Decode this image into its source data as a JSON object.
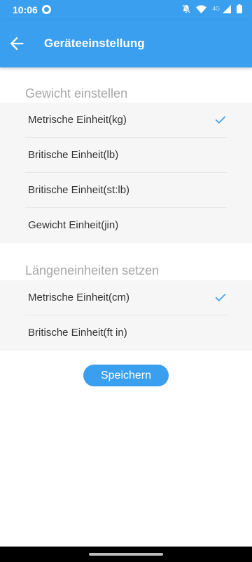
{
  "status_bar": {
    "time": "10:06",
    "network_label": "4G",
    "icons": [
      "app-notification-icon",
      "bell-off-icon",
      "wifi-icon",
      "signal-icon",
      "battery-icon"
    ]
  },
  "app_bar": {
    "title": "Geräteeinstellung",
    "back_icon": "arrow-back-icon"
  },
  "weight_section": {
    "header": "Gewicht einstellen",
    "options": [
      {
        "label": "Metrische Einheit(kg)",
        "selected": true
      },
      {
        "label": "Britische Einheit(lb)",
        "selected": false
      },
      {
        "label": "Britische Einheit(st:lb)",
        "selected": false
      },
      {
        "label": "Gewicht Einheit(jin)",
        "selected": false
      }
    ]
  },
  "length_section": {
    "header": "Längeneinheiten setzen",
    "options": [
      {
        "label": "Metrische Einheit(cm)",
        "selected": true
      },
      {
        "label": "Britische Einheit(ft in)",
        "selected": false
      }
    ]
  },
  "save_button": {
    "label": "Speichern"
  },
  "colors": {
    "accent": "#3a9fee",
    "section_bg": "#f6f6f6",
    "header_text": "#a6a6a6"
  }
}
